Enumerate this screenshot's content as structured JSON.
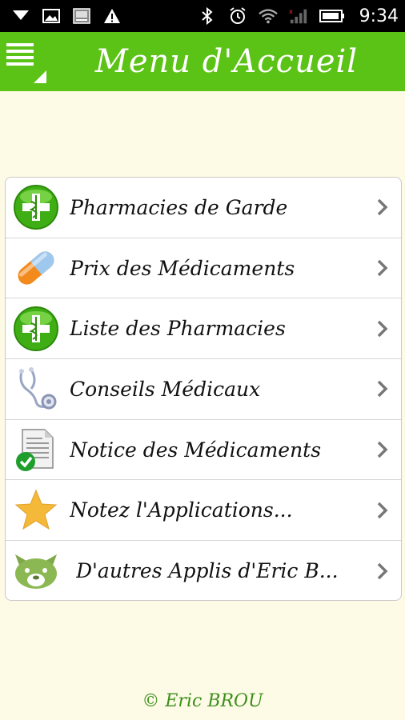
{
  "status_bar": {
    "time": "9:34",
    "left_icons": [
      "download-icon",
      "image-icon",
      "photo-icon",
      "warning-icon"
    ],
    "right_icons": [
      "bluetooth-icon",
      "alarm-icon",
      "wifi-icon",
      "signal-icon",
      "battery-icon"
    ]
  },
  "header": {
    "title": "Menu d'Accueil",
    "menu_icon": "hamburger-menu-icon",
    "background_color": "#5bc216"
  },
  "menu": {
    "items": [
      {
        "label": "Pharmacies de Garde",
        "icon": "pharmacy-cross-icon"
      },
      {
        "label": "Prix des Médicaments",
        "icon": "pill-capsule-icon"
      },
      {
        "label": "Liste des Pharmacies",
        "icon": "pharmacy-cross-icon"
      },
      {
        "label": "Conseils Médicaux",
        "icon": "stethoscope-icon"
      },
      {
        "label": "Notice des Médicaments",
        "icon": "document-check-icon"
      },
      {
        "label": "Notez l'Applications...",
        "icon": "star-icon"
      },
      {
        "label": "D'autres Applis d'Eric B...",
        "icon": "android-bear-icon"
      }
    ]
  },
  "footer": {
    "text": "© Eric BROU"
  }
}
